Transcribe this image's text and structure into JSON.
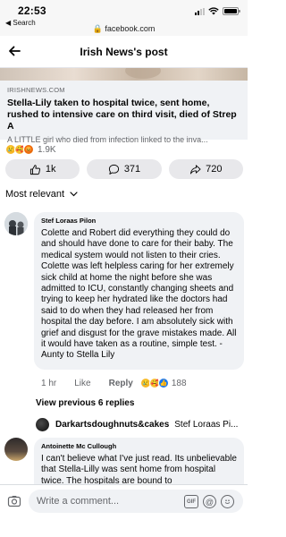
{
  "status_bar": {
    "time": "22:53",
    "back_label": "◀ Search",
    "url": "🔒 facebook.com"
  },
  "navbar": {
    "title": "Irish News's post"
  },
  "link_card": {
    "source": "IRISHNEWS.COM",
    "title": "Stella-Lily taken to hospital twice, sent home, rushed to intensive care on third visit, died of Strep A",
    "description": "A LITTLE girl who died from infection linked to the inva..."
  },
  "post_reactions": {
    "count": "1.9K",
    "types": [
      "sad",
      "care",
      "angry"
    ]
  },
  "actions": {
    "likes": "1k",
    "comments": "371",
    "shares": "720"
  },
  "sort": {
    "label": "Most relevant"
  },
  "comment_1": {
    "author": "Stef Loraas Pilon",
    "text": "Colette and Robert did everything they could do and should have done to care for their baby. The medical system would not listen to their cries. Colette was left helpless caring for her extremely sick child at home the night before she was admitted to ICU, constantly changing sheets and trying to keep her hydrated like the doctors had said to do when they had released her from hospital the day before. I am absolutely sick with grief and disgust for the grave mistakes made. All it would have taken as a routine, simple test. -Aunty to Stella Lily",
    "time": "1 hr",
    "like_label": "Like",
    "reply_label": "Reply",
    "reaction_count": "188"
  },
  "view_previous": {
    "label": "View previous 6 replies"
  },
  "reply_preview": {
    "author": "Darkartsdoughnuts&cakes",
    "text": "Stef Loraas Pi..."
  },
  "comment_2": {
    "author": "Antoinette Mc Cullough",
    "text": "I can't believe what I've just read. Its unbelievable that Stella-Lilly was sent home from hospital twice. The hospitals are bound to"
  },
  "composer": {
    "placeholder": "Write a comment...",
    "gif_label": "GIF",
    "at_label": "@"
  },
  "colors": {
    "accent": "#1877f2",
    "bubble": "#f0f2f5",
    "meta": "#65676b"
  }
}
